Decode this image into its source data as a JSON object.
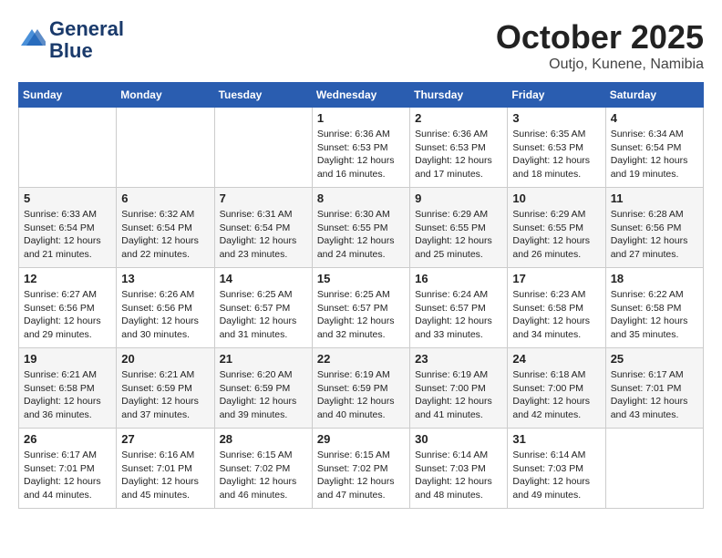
{
  "header": {
    "logo_line1": "General",
    "logo_line2": "Blue",
    "month_year": "October 2025",
    "location": "Outjo, Kunene, Namibia"
  },
  "weekdays": [
    "Sunday",
    "Monday",
    "Tuesday",
    "Wednesday",
    "Thursday",
    "Friday",
    "Saturday"
  ],
  "weeks": [
    [
      {
        "day": "",
        "sunrise": "",
        "sunset": "",
        "daylight": ""
      },
      {
        "day": "",
        "sunrise": "",
        "sunset": "",
        "daylight": ""
      },
      {
        "day": "",
        "sunrise": "",
        "sunset": "",
        "daylight": ""
      },
      {
        "day": "1",
        "sunrise": "Sunrise: 6:36 AM",
        "sunset": "Sunset: 6:53 PM",
        "daylight": "Daylight: 12 hours and 16 minutes."
      },
      {
        "day": "2",
        "sunrise": "Sunrise: 6:36 AM",
        "sunset": "Sunset: 6:53 PM",
        "daylight": "Daylight: 12 hours and 17 minutes."
      },
      {
        "day": "3",
        "sunrise": "Sunrise: 6:35 AM",
        "sunset": "Sunset: 6:53 PM",
        "daylight": "Daylight: 12 hours and 18 minutes."
      },
      {
        "day": "4",
        "sunrise": "Sunrise: 6:34 AM",
        "sunset": "Sunset: 6:54 PM",
        "daylight": "Daylight: 12 hours and 19 minutes."
      }
    ],
    [
      {
        "day": "5",
        "sunrise": "Sunrise: 6:33 AM",
        "sunset": "Sunset: 6:54 PM",
        "daylight": "Daylight: 12 hours and 21 minutes."
      },
      {
        "day": "6",
        "sunrise": "Sunrise: 6:32 AM",
        "sunset": "Sunset: 6:54 PM",
        "daylight": "Daylight: 12 hours and 22 minutes."
      },
      {
        "day": "7",
        "sunrise": "Sunrise: 6:31 AM",
        "sunset": "Sunset: 6:54 PM",
        "daylight": "Daylight: 12 hours and 23 minutes."
      },
      {
        "day": "8",
        "sunrise": "Sunrise: 6:30 AM",
        "sunset": "Sunset: 6:55 PM",
        "daylight": "Daylight: 12 hours and 24 minutes."
      },
      {
        "day": "9",
        "sunrise": "Sunrise: 6:29 AM",
        "sunset": "Sunset: 6:55 PM",
        "daylight": "Daylight: 12 hours and 25 minutes."
      },
      {
        "day": "10",
        "sunrise": "Sunrise: 6:29 AM",
        "sunset": "Sunset: 6:55 PM",
        "daylight": "Daylight: 12 hours and 26 minutes."
      },
      {
        "day": "11",
        "sunrise": "Sunrise: 6:28 AM",
        "sunset": "Sunset: 6:56 PM",
        "daylight": "Daylight: 12 hours and 27 minutes."
      }
    ],
    [
      {
        "day": "12",
        "sunrise": "Sunrise: 6:27 AM",
        "sunset": "Sunset: 6:56 PM",
        "daylight": "Daylight: 12 hours and 29 minutes."
      },
      {
        "day": "13",
        "sunrise": "Sunrise: 6:26 AM",
        "sunset": "Sunset: 6:56 PM",
        "daylight": "Daylight: 12 hours and 30 minutes."
      },
      {
        "day": "14",
        "sunrise": "Sunrise: 6:25 AM",
        "sunset": "Sunset: 6:57 PM",
        "daylight": "Daylight: 12 hours and 31 minutes."
      },
      {
        "day": "15",
        "sunrise": "Sunrise: 6:25 AM",
        "sunset": "Sunset: 6:57 PM",
        "daylight": "Daylight: 12 hours and 32 minutes."
      },
      {
        "day": "16",
        "sunrise": "Sunrise: 6:24 AM",
        "sunset": "Sunset: 6:57 PM",
        "daylight": "Daylight: 12 hours and 33 minutes."
      },
      {
        "day": "17",
        "sunrise": "Sunrise: 6:23 AM",
        "sunset": "Sunset: 6:58 PM",
        "daylight": "Daylight: 12 hours and 34 minutes."
      },
      {
        "day": "18",
        "sunrise": "Sunrise: 6:22 AM",
        "sunset": "Sunset: 6:58 PM",
        "daylight": "Daylight: 12 hours and 35 minutes."
      }
    ],
    [
      {
        "day": "19",
        "sunrise": "Sunrise: 6:21 AM",
        "sunset": "Sunset: 6:58 PM",
        "daylight": "Daylight: 12 hours and 36 minutes."
      },
      {
        "day": "20",
        "sunrise": "Sunrise: 6:21 AM",
        "sunset": "Sunset: 6:59 PM",
        "daylight": "Daylight: 12 hours and 37 minutes."
      },
      {
        "day": "21",
        "sunrise": "Sunrise: 6:20 AM",
        "sunset": "Sunset: 6:59 PM",
        "daylight": "Daylight: 12 hours and 39 minutes."
      },
      {
        "day": "22",
        "sunrise": "Sunrise: 6:19 AM",
        "sunset": "Sunset: 6:59 PM",
        "daylight": "Daylight: 12 hours and 40 minutes."
      },
      {
        "day": "23",
        "sunrise": "Sunrise: 6:19 AM",
        "sunset": "Sunset: 7:00 PM",
        "daylight": "Daylight: 12 hours and 41 minutes."
      },
      {
        "day": "24",
        "sunrise": "Sunrise: 6:18 AM",
        "sunset": "Sunset: 7:00 PM",
        "daylight": "Daylight: 12 hours and 42 minutes."
      },
      {
        "day": "25",
        "sunrise": "Sunrise: 6:17 AM",
        "sunset": "Sunset: 7:01 PM",
        "daylight": "Daylight: 12 hours and 43 minutes."
      }
    ],
    [
      {
        "day": "26",
        "sunrise": "Sunrise: 6:17 AM",
        "sunset": "Sunset: 7:01 PM",
        "daylight": "Daylight: 12 hours and 44 minutes."
      },
      {
        "day": "27",
        "sunrise": "Sunrise: 6:16 AM",
        "sunset": "Sunset: 7:01 PM",
        "daylight": "Daylight: 12 hours and 45 minutes."
      },
      {
        "day": "28",
        "sunrise": "Sunrise: 6:15 AM",
        "sunset": "Sunset: 7:02 PM",
        "daylight": "Daylight: 12 hours and 46 minutes."
      },
      {
        "day": "29",
        "sunrise": "Sunrise: 6:15 AM",
        "sunset": "Sunset: 7:02 PM",
        "daylight": "Daylight: 12 hours and 47 minutes."
      },
      {
        "day": "30",
        "sunrise": "Sunrise: 6:14 AM",
        "sunset": "Sunset: 7:03 PM",
        "daylight": "Daylight: 12 hours and 48 minutes."
      },
      {
        "day": "31",
        "sunrise": "Sunrise: 6:14 AM",
        "sunset": "Sunset: 7:03 PM",
        "daylight": "Daylight: 12 hours and 49 minutes."
      },
      {
        "day": "",
        "sunrise": "",
        "sunset": "",
        "daylight": ""
      }
    ]
  ]
}
